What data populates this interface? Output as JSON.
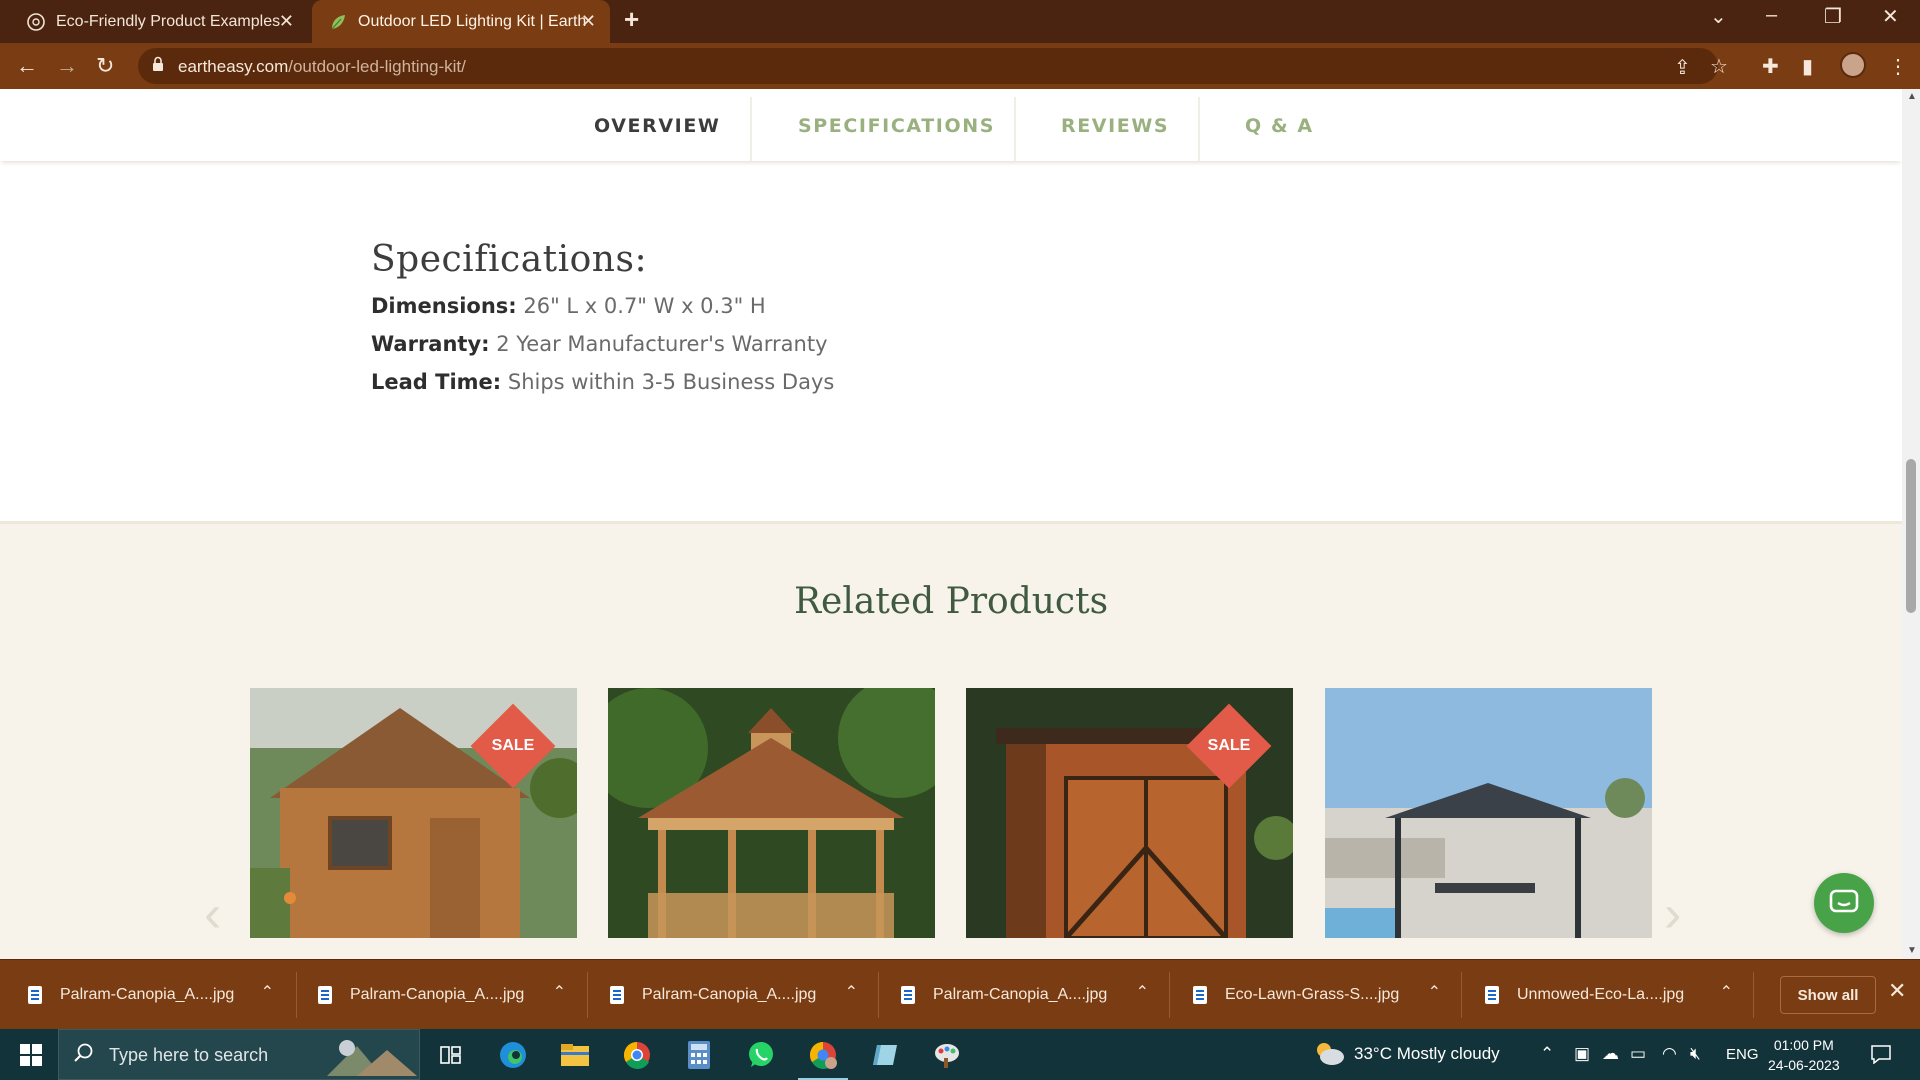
{
  "browser": {
    "tabs": [
      {
        "title": "Eco-Friendly Product Examples",
        "active": false
      },
      {
        "title": "Outdoor LED Lighting Kit | Earthe",
        "active": true
      }
    ],
    "url_domain": "eartheasy.com",
    "url_path": "/outdoor-led-lighting-kit/"
  },
  "page": {
    "subnav": {
      "items": [
        "OVERVIEW",
        "SPECIFICATIONS",
        "REVIEWS",
        "Q & A"
      ],
      "active_index": 0
    },
    "specs": {
      "heading": "Specifications:",
      "rows": [
        {
          "key": "Dimensions:",
          "value": "26\" L x 0.7\" W x 0.3\" H"
        },
        {
          "key": "Warranty:",
          "value": "2 Year Manufacturer's Warranty"
        },
        {
          "key": "Lead Time:",
          "value": "Ships within 3-5 Business Days"
        }
      ]
    },
    "related": {
      "heading": "Related Products",
      "products": [
        {
          "image": "wooden-playhouse-photo",
          "badge": "SALE"
        },
        {
          "image": "wooden-gazebo-photo",
          "badge": ""
        },
        {
          "image": "wooden-shed-photo",
          "badge": "SALE"
        },
        {
          "image": "metal-gazebo-photo",
          "badge": ""
        }
      ]
    }
  },
  "downloads": {
    "items": [
      "Palram-Canopia_A....jpg",
      "Palram-Canopia_A....jpg",
      "Palram-Canopia_A....jpg",
      "Palram-Canopia_A....jpg",
      "Eco-Lawn-Grass-S....jpg",
      "Unmowed-Eco-La....jpg"
    ],
    "show_all": "Show all"
  },
  "taskbar": {
    "search_placeholder": "Type here to search",
    "weather": "33°C  Mostly cloudy",
    "language": "ENG",
    "time": "01:00 PM",
    "date": "24-06-2023"
  },
  "colors": {
    "chrome_dark": "#4a2410",
    "chrome": "#7a3c12",
    "subnav_inactive": "#9ab07f",
    "heading_green": "#3f5a40",
    "sale_badge": "#e25b48",
    "chat_button": "#48a348",
    "taskbar": "#13333a"
  }
}
